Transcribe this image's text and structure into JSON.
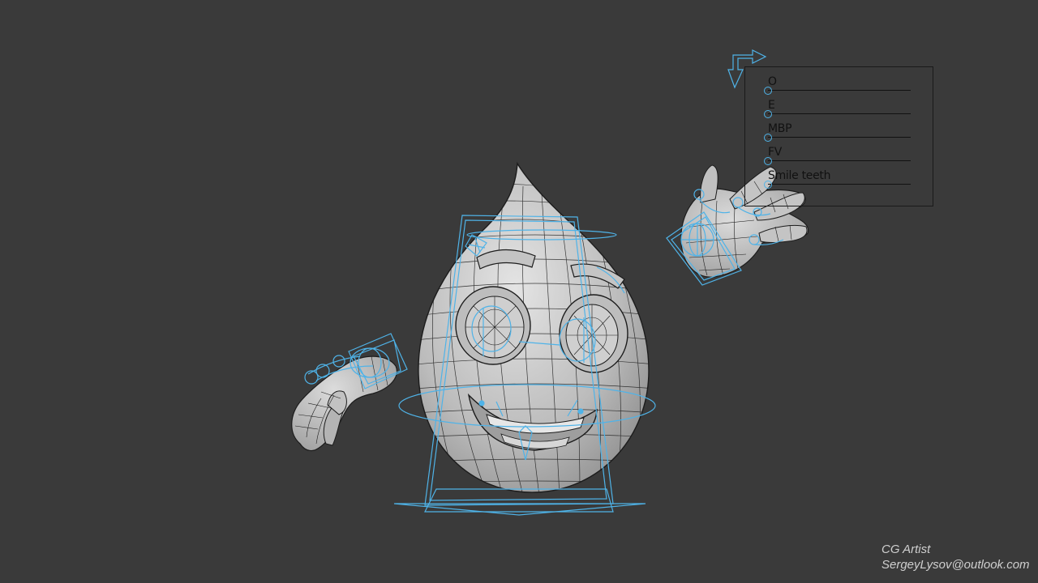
{
  "morph_panel": {
    "sliders": [
      {
        "label": "O"
      },
      {
        "label": "E"
      },
      {
        "label": "MBP"
      },
      {
        "label": "FV"
      },
      {
        "label": "Smile teeth"
      }
    ]
  },
  "credits": {
    "role": "CG Artist",
    "email": "SergeyLysov@outlook.com"
  },
  "colors": {
    "background": "#3a3a3a",
    "rig_controls": "#4fb3e8",
    "mesh": "#c9c9c9",
    "wireframe": "#1c1c1c"
  }
}
